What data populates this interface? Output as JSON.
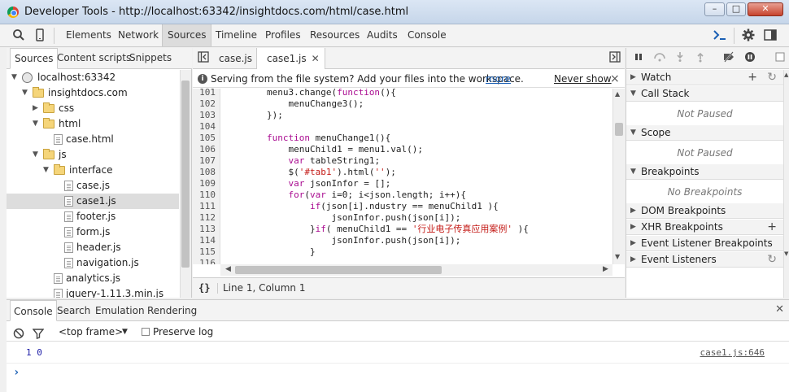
{
  "window": {
    "title": "Developer Tools - http://localhost:63342/insightdocs.com/html/case.html",
    "controls": [
      "–",
      "□",
      "✕"
    ]
  },
  "toolbar": {
    "tabs": [
      "Elements",
      "Network",
      "Sources",
      "Timeline",
      "Profiles",
      "Resources",
      "Audits",
      "Console"
    ],
    "active_tab": "Sources"
  },
  "navigator": {
    "tabs": [
      "Sources",
      "Content scripts",
      "Snippets"
    ],
    "tree": [
      {
        "label": "localhost:63342",
        "kind": "domain",
        "depth": 0,
        "open": true
      },
      {
        "label": "insightdocs.com",
        "kind": "folder",
        "depth": 1,
        "open": true
      },
      {
        "label": "css",
        "kind": "folder",
        "depth": 2,
        "open": false
      },
      {
        "label": "html",
        "kind": "folder",
        "depth": 2,
        "open": true
      },
      {
        "label": "case.html",
        "kind": "file",
        "depth": 3
      },
      {
        "label": "js",
        "kind": "folder",
        "depth": 2,
        "open": true
      },
      {
        "label": "interface",
        "kind": "folder",
        "depth": 3,
        "open": true
      },
      {
        "label": "case.js",
        "kind": "file",
        "depth": 4
      },
      {
        "label": "case1.js",
        "kind": "file",
        "depth": 4,
        "selected": true
      },
      {
        "label": "footer.js",
        "kind": "file",
        "depth": 4
      },
      {
        "label": "form.js",
        "kind": "file",
        "depth": 4
      },
      {
        "label": "header.js",
        "kind": "file",
        "depth": 4
      },
      {
        "label": "navigation.js",
        "kind": "file",
        "depth": 4
      },
      {
        "label": "analytics.js",
        "kind": "file",
        "depth": 3
      },
      {
        "label": "jquery-1.11.3.min.js",
        "kind": "file",
        "depth": 3
      }
    ]
  },
  "editor": {
    "tabs": [
      {
        "label": "case.js",
        "active": false
      },
      {
        "label": "case1.js",
        "active": true,
        "closable": true
      }
    ],
    "infobar": {
      "message": "Serving from the file system? Add your files into the workspace.",
      "more_link": "more",
      "never_show": "Never show",
      "close": "×"
    },
    "lines": [
      {
        "n": "101",
        "t": "        menu3.change(function(){"
      },
      {
        "n": "102",
        "t": "            menuChange3();"
      },
      {
        "n": "103",
        "t": "        });"
      },
      {
        "n": "104",
        "t": ""
      },
      {
        "n": "105",
        "t": "        function menuChange1(){"
      },
      {
        "n": "106",
        "t": "            menuChild1 = menu1.val();"
      },
      {
        "n": "107",
        "t": "            var tableString1;"
      },
      {
        "n": "108",
        "t": "            $('#tab1').html('');"
      },
      {
        "n": "109",
        "t": "            var jsonInfor = [];"
      },
      {
        "n": "110",
        "t": "            for(var i=0; i<json.length; i++){"
      },
      {
        "n": "111",
        "t": "                if(json[i].ndustry == menuChild1 ){"
      },
      {
        "n": "112",
        "t": "                    jsonInfor.push(json[i]);"
      },
      {
        "n": "113",
        "t": "                }if( menuChild1 == '行业电子传真应用案例' ){"
      },
      {
        "n": "114",
        "t": "                    jsonInfor.push(json[i]);"
      },
      {
        "n": "115",
        "t": "                }"
      },
      {
        "n": "116",
        "t": ""
      }
    ],
    "status": {
      "format_icon": "{}",
      "cursor": "Line 1, Column 1"
    }
  },
  "debugger": {
    "sections": [
      {
        "title": "Watch",
        "open": false,
        "actions": [
          "+",
          "↻"
        ]
      },
      {
        "title": "Call Stack",
        "open": true,
        "body": "Not Paused"
      },
      {
        "title": "Scope",
        "open": true,
        "body": "Not Paused"
      },
      {
        "title": "Breakpoints",
        "open": true,
        "body": "No Breakpoints"
      },
      {
        "title": "DOM Breakpoints",
        "open": false
      },
      {
        "title": "XHR Breakpoints",
        "open": false,
        "actions": [
          "+"
        ]
      },
      {
        "title": "Event Listener Breakpoints",
        "open": false
      },
      {
        "title": "Event Listeners",
        "open": false,
        "actions": [
          "↻"
        ]
      }
    ]
  },
  "console": {
    "tabs": [
      "Console",
      "Search",
      "Emulation",
      "Rendering"
    ],
    "frame": "<top frame>",
    "preserve_log": "Preserve log",
    "message": "1 0",
    "source": "case1.js:646",
    "prompt": "›"
  },
  "colors": {
    "keyword": "#aa0d91",
    "string": "#c41a16",
    "link": "#1a5fb4",
    "active_tab_bg": "#dcdcdc"
  }
}
